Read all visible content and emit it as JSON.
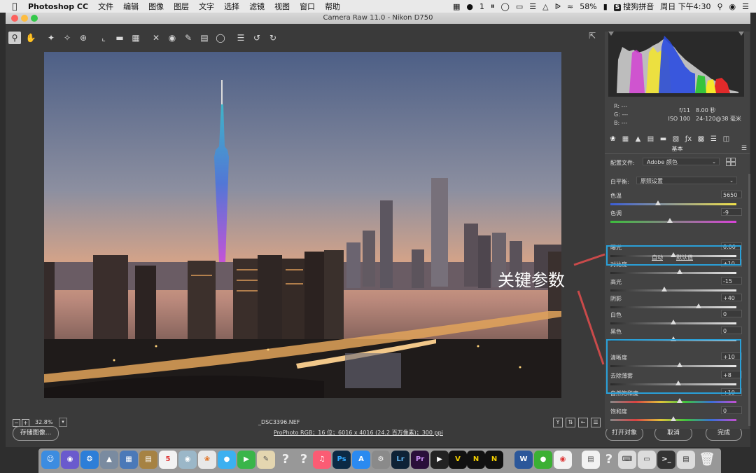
{
  "menubar": {
    "app": "Photoshop CC",
    "items": [
      "文件",
      "编辑",
      "图像",
      "图层",
      "文字",
      "选择",
      "滤镜",
      "视图",
      "窗口",
      "帮助"
    ],
    "status_number": "1",
    "battery": "58%",
    "input_method": "搜狗拼音",
    "clock": "周日 下午4:30"
  },
  "window": {
    "title": "Camera Raw 11.0  -  Nikon D750"
  },
  "toolbar": {
    "icons": [
      "zoom-tool-icon",
      "hand-tool-icon",
      "white-balance-tool-icon",
      "color-sampler-tool-icon",
      "targeted-adjustment-tool-icon",
      "crop-tool-icon",
      "straighten-tool-icon",
      "transform-tool-icon",
      "spot-removal-tool-icon",
      "red-eye-tool-icon",
      "adjustment-brush-icon",
      "graduated-filter-icon",
      "radial-filter-icon",
      "preferences-icon",
      "rotate-left-icon",
      "rotate-right-icon"
    ]
  },
  "status": {
    "zoom": "32.8%",
    "filename": "_DSC3396.NEF"
  },
  "bottom": {
    "save_label": "存储图像...",
    "workflow": "ProPhoto RGB；16 位；6016 x 4016 (24.2 百万像素)；300 ppi",
    "open_label": "打开对象",
    "cancel_label": "取消",
    "done_label": "完成"
  },
  "histogram": {
    "r": "R:   ---",
    "g": "G:   ---",
    "b": "B:   ---",
    "aperture": "f/11",
    "shutter": "8.00 秒",
    "iso": "ISO 100",
    "lens": "24-120@38 毫米"
  },
  "panel": {
    "section_title": "基本",
    "profile_label": "配置文件:",
    "profile_value": "Adobe 颜色",
    "wb_label": "白平衡:",
    "wb_value": "原照设置",
    "auto_label": "自动",
    "default_label": "默认值",
    "sliders": [
      {
        "label": "色温",
        "value": "5650",
        "pos": 0.38
      },
      {
        "label": "色调",
        "value": "-9",
        "pos": 0.47
      },
      {
        "label": "曝光",
        "value": "0.00",
        "pos": 0.5
      },
      {
        "label": "对比度",
        "value": "+10",
        "pos": 0.55
      },
      {
        "label": "高光",
        "value": "-15",
        "pos": 0.43
      },
      {
        "label": "阴影",
        "value": "+40",
        "pos": 0.7
      },
      {
        "label": "白色",
        "value": "0",
        "pos": 0.5
      },
      {
        "label": "黑色",
        "value": "0",
        "pos": 0.5
      },
      {
        "label": "清晰度",
        "value": "+10",
        "pos": 0.55
      },
      {
        "label": "去除薄雾",
        "value": "+8",
        "pos": 0.54
      },
      {
        "label": "自然饱和度",
        "value": "+10",
        "pos": 0.55
      },
      {
        "label": "饱和度",
        "value": "0",
        "pos": 0.5
      }
    ]
  },
  "annotation": {
    "callout": "关键参数",
    "color": "#2aa0d8"
  }
}
